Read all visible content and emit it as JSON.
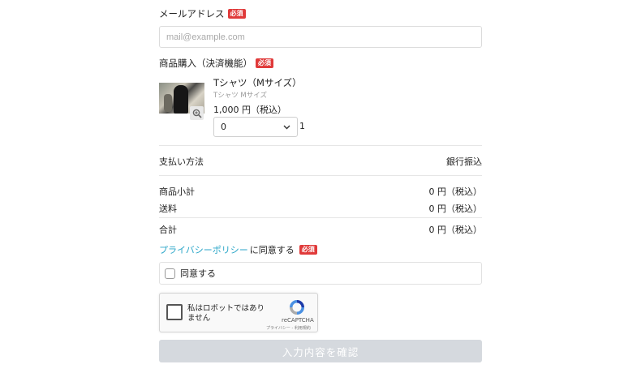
{
  "email": {
    "label": "メールアドレス",
    "required_badge": "必須",
    "placeholder": "mail@example.com",
    "value": ""
  },
  "purchase": {
    "label": "商品購入（決済機能）",
    "required_badge": "必須",
    "product": {
      "name": "Tシャツ（Mサイズ）",
      "sub": "Tシャツ Mサイズ",
      "price": "1,000 円（税込）",
      "quantity_selected": "0",
      "quantity_max": "1",
      "zoom_icon": "zoom-in-icon"
    }
  },
  "payment": {
    "label": "支払い方法",
    "value": "銀行振込"
  },
  "summary": {
    "subtotal_label": "商品小計",
    "subtotal_value": "0 円（税込）",
    "shipping_label": "送料",
    "shipping_value": "0 円（税込）",
    "total_label": "合計",
    "total_value": "0 円（税込）"
  },
  "privacy": {
    "link_text": "プライバシーポリシー",
    "suffix": "に同意する",
    "required_badge": "必須",
    "checkbox_label": "同意する"
  },
  "recaptcha": {
    "label": "私はロボットではありません",
    "brand": "reCAPTCHA",
    "terms": "プライバシー - 利用規約",
    "icon": "recaptcha-logo-icon"
  },
  "submit_label": "入力内容を確認",
  "colors": {
    "required_badge": "#e03a3a",
    "link": "#2aa6c8",
    "submit_disabled": "#d5d9de"
  }
}
